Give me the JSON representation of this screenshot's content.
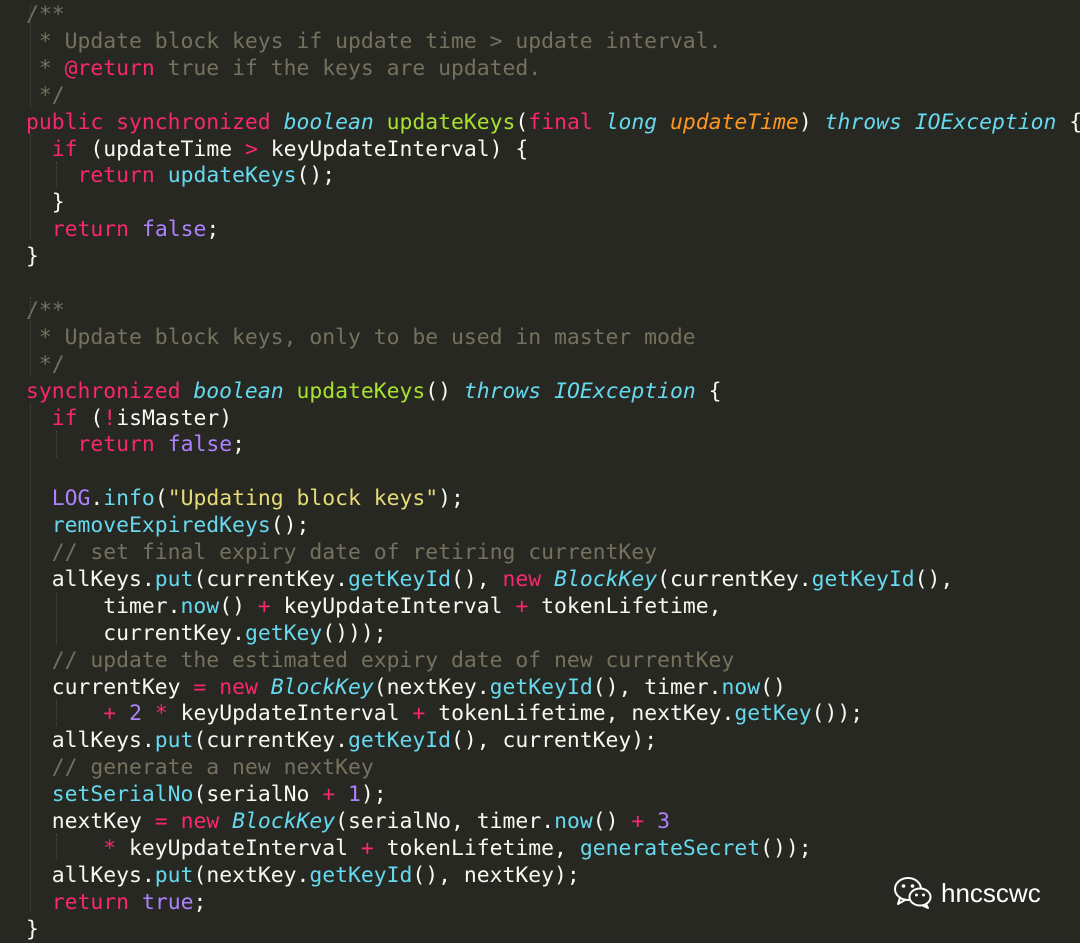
{
  "code": {
    "lines": [
      [
        {
          "t": "/**",
          "c": "comment"
        }
      ],
      [
        {
          "t": " * Update block keys if update time > update interval.",
          "c": "comment"
        }
      ],
      [
        {
          "t": " * ",
          "c": "comment"
        },
        {
          "t": "@return",
          "c": "anno"
        },
        {
          "t": " true if the keys are updated.",
          "c": "comment"
        }
      ],
      [
        {
          "t": " */",
          "c": "comment"
        }
      ],
      [
        {
          "t": "public synchronized ",
          "c": "kw"
        },
        {
          "t": "boolean",
          "c": "type"
        },
        {
          "t": " ",
          "c": "plain"
        },
        {
          "t": "updateKeys",
          "c": "fn"
        },
        {
          "t": "(",
          "c": "plain"
        },
        {
          "t": "final",
          "c": "kw"
        },
        {
          "t": " ",
          "c": "plain"
        },
        {
          "t": "long",
          "c": "type"
        },
        {
          "t": " ",
          "c": "plain"
        },
        {
          "t": "updateTime",
          "c": "param"
        },
        {
          "t": ") ",
          "c": "plain"
        },
        {
          "t": "throws",
          "c": "type"
        },
        {
          "t": " ",
          "c": "plain"
        },
        {
          "t": "IOException",
          "c": "cls"
        },
        {
          "t": " {",
          "c": "plain"
        }
      ],
      [
        {
          "t": "  ",
          "c": "plain"
        },
        {
          "t": "if",
          "c": "kw"
        },
        {
          "t": " (updateTime ",
          "c": "plain"
        },
        {
          "t": ">",
          "c": "op"
        },
        {
          "t": " keyUpdateInterval) {",
          "c": "plain"
        }
      ],
      [
        {
          "t": "    ",
          "c": "plain"
        },
        {
          "t": "return",
          "c": "kw"
        },
        {
          "t": " ",
          "c": "plain"
        },
        {
          "t": "updateKeys",
          "c": "call"
        },
        {
          "t": "();",
          "c": "plain"
        }
      ],
      [
        {
          "t": "  }",
          "c": "plain"
        }
      ],
      [
        {
          "t": "  ",
          "c": "plain"
        },
        {
          "t": "return",
          "c": "kw"
        },
        {
          "t": " ",
          "c": "plain"
        },
        {
          "t": "false",
          "c": "const"
        },
        {
          "t": ";",
          "c": "plain"
        }
      ],
      [
        {
          "t": "}",
          "c": "plain"
        }
      ],
      [],
      [
        {
          "t": "/**",
          "c": "comment"
        }
      ],
      [
        {
          "t": " * Update block keys, only to be used in master mode",
          "c": "comment"
        }
      ],
      [
        {
          "t": " */",
          "c": "comment"
        }
      ],
      [
        {
          "t": "synchronized ",
          "c": "kw"
        },
        {
          "t": "boolean",
          "c": "type"
        },
        {
          "t": " ",
          "c": "plain"
        },
        {
          "t": "updateKeys",
          "c": "fn"
        },
        {
          "t": "() ",
          "c": "plain"
        },
        {
          "t": "throws",
          "c": "type"
        },
        {
          "t": " ",
          "c": "plain"
        },
        {
          "t": "IOException",
          "c": "cls"
        },
        {
          "t": " {",
          "c": "plain"
        }
      ],
      [
        {
          "t": "  ",
          "c": "plain"
        },
        {
          "t": "if",
          "c": "kw"
        },
        {
          "t": " (",
          "c": "plain"
        },
        {
          "t": "!",
          "c": "op"
        },
        {
          "t": "isMaster)",
          "c": "plain"
        }
      ],
      [
        {
          "t": "    ",
          "c": "plain"
        },
        {
          "t": "return",
          "c": "kw"
        },
        {
          "t": " ",
          "c": "plain"
        },
        {
          "t": "false",
          "c": "const"
        },
        {
          "t": ";",
          "c": "plain"
        }
      ],
      [],
      [
        {
          "t": "  ",
          "c": "plain"
        },
        {
          "t": "LOG",
          "c": "const"
        },
        {
          "t": ".",
          "c": "plain"
        },
        {
          "t": "info",
          "c": "call"
        },
        {
          "t": "(",
          "c": "plain"
        },
        {
          "t": "\"Updating block keys\"",
          "c": "str"
        },
        {
          "t": ");",
          "c": "plain"
        }
      ],
      [
        {
          "t": "  ",
          "c": "plain"
        },
        {
          "t": "removeExpiredKeys",
          "c": "call"
        },
        {
          "t": "();",
          "c": "plain"
        }
      ],
      [
        {
          "t": "  // set final expiry date of retiring currentKey",
          "c": "comment"
        }
      ],
      [
        {
          "t": "  allKeys.",
          "c": "plain"
        },
        {
          "t": "put",
          "c": "call"
        },
        {
          "t": "(currentKey.",
          "c": "plain"
        },
        {
          "t": "getKeyId",
          "c": "call"
        },
        {
          "t": "(), ",
          "c": "plain"
        },
        {
          "t": "new",
          "c": "kw"
        },
        {
          "t": " ",
          "c": "plain"
        },
        {
          "t": "BlockKey",
          "c": "cls"
        },
        {
          "t": "(currentKey.",
          "c": "plain"
        },
        {
          "t": "getKeyId",
          "c": "call"
        },
        {
          "t": "(),",
          "c": "plain"
        }
      ],
      [
        {
          "t": "      timer.",
          "c": "plain"
        },
        {
          "t": "now",
          "c": "call"
        },
        {
          "t": "() ",
          "c": "plain"
        },
        {
          "t": "+",
          "c": "op"
        },
        {
          "t": " keyUpdateInterval ",
          "c": "plain"
        },
        {
          "t": "+",
          "c": "op"
        },
        {
          "t": " tokenLifetime,",
          "c": "plain"
        }
      ],
      [
        {
          "t": "      currentKey.",
          "c": "plain"
        },
        {
          "t": "getKey",
          "c": "call"
        },
        {
          "t": "()));",
          "c": "plain"
        }
      ],
      [
        {
          "t": "  // update the estimated expiry date of new currentKey",
          "c": "comment"
        }
      ],
      [
        {
          "t": "  currentKey ",
          "c": "plain"
        },
        {
          "t": "=",
          "c": "op"
        },
        {
          "t": " ",
          "c": "plain"
        },
        {
          "t": "new",
          "c": "kw"
        },
        {
          "t": " ",
          "c": "plain"
        },
        {
          "t": "BlockKey",
          "c": "cls"
        },
        {
          "t": "(nextKey.",
          "c": "plain"
        },
        {
          "t": "getKeyId",
          "c": "call"
        },
        {
          "t": "(), timer.",
          "c": "plain"
        },
        {
          "t": "now",
          "c": "call"
        },
        {
          "t": "()",
          "c": "plain"
        }
      ],
      [
        {
          "t": "      ",
          "c": "plain"
        },
        {
          "t": "+",
          "c": "op"
        },
        {
          "t": " ",
          "c": "plain"
        },
        {
          "t": "2",
          "c": "const"
        },
        {
          "t": " ",
          "c": "plain"
        },
        {
          "t": "*",
          "c": "op"
        },
        {
          "t": " keyUpdateInterval ",
          "c": "plain"
        },
        {
          "t": "+",
          "c": "op"
        },
        {
          "t": " tokenLifetime, nextKey.",
          "c": "plain"
        },
        {
          "t": "getKey",
          "c": "call"
        },
        {
          "t": "());",
          "c": "plain"
        }
      ],
      [
        {
          "t": "  allKeys.",
          "c": "plain"
        },
        {
          "t": "put",
          "c": "call"
        },
        {
          "t": "(currentKey.",
          "c": "plain"
        },
        {
          "t": "getKeyId",
          "c": "call"
        },
        {
          "t": "(), currentKey);",
          "c": "plain"
        }
      ],
      [
        {
          "t": "  // generate a new nextKey",
          "c": "comment"
        }
      ],
      [
        {
          "t": "  ",
          "c": "plain"
        },
        {
          "t": "setSerialNo",
          "c": "call"
        },
        {
          "t": "(serialNo ",
          "c": "plain"
        },
        {
          "t": "+",
          "c": "op"
        },
        {
          "t": " ",
          "c": "plain"
        },
        {
          "t": "1",
          "c": "const"
        },
        {
          "t": ");",
          "c": "plain"
        }
      ],
      [
        {
          "t": "  nextKey ",
          "c": "plain"
        },
        {
          "t": "=",
          "c": "op"
        },
        {
          "t": " ",
          "c": "plain"
        },
        {
          "t": "new",
          "c": "kw"
        },
        {
          "t": " ",
          "c": "plain"
        },
        {
          "t": "BlockKey",
          "c": "cls"
        },
        {
          "t": "(serialNo, timer.",
          "c": "plain"
        },
        {
          "t": "now",
          "c": "call"
        },
        {
          "t": "() ",
          "c": "plain"
        },
        {
          "t": "+",
          "c": "op"
        },
        {
          "t": " ",
          "c": "plain"
        },
        {
          "t": "3",
          "c": "const"
        }
      ],
      [
        {
          "t": "      ",
          "c": "plain"
        },
        {
          "t": "*",
          "c": "op"
        },
        {
          "t": " keyUpdateInterval ",
          "c": "plain"
        },
        {
          "t": "+",
          "c": "op"
        },
        {
          "t": " tokenLifetime, ",
          "c": "plain"
        },
        {
          "t": "generateSecret",
          "c": "call"
        },
        {
          "t": "());",
          "c": "plain"
        }
      ],
      [
        {
          "t": "  allKeys.",
          "c": "plain"
        },
        {
          "t": "put",
          "c": "call"
        },
        {
          "t": "(nextKey.",
          "c": "plain"
        },
        {
          "t": "getKeyId",
          "c": "call"
        },
        {
          "t": "(), nextKey);",
          "c": "plain"
        }
      ],
      [
        {
          "t": "  ",
          "c": "plain"
        },
        {
          "t": "return",
          "c": "kw"
        },
        {
          "t": " ",
          "c": "plain"
        },
        {
          "t": "true",
          "c": "const"
        },
        {
          "t": ";",
          "c": "plain"
        }
      ],
      [
        {
          "t": "}",
          "c": "plain"
        }
      ]
    ]
  },
  "watermark": {
    "icon": "wechat-icon",
    "text": "hncscwc"
  },
  "colors": {
    "background": "#272822",
    "text": "#f8f8f2",
    "comment": "#75715e",
    "keyword": "#f92672",
    "type": "#66d9ef",
    "function": "#a6e22e",
    "parameter": "#fd971f",
    "constant": "#ae81ff",
    "string": "#e6db74"
  }
}
